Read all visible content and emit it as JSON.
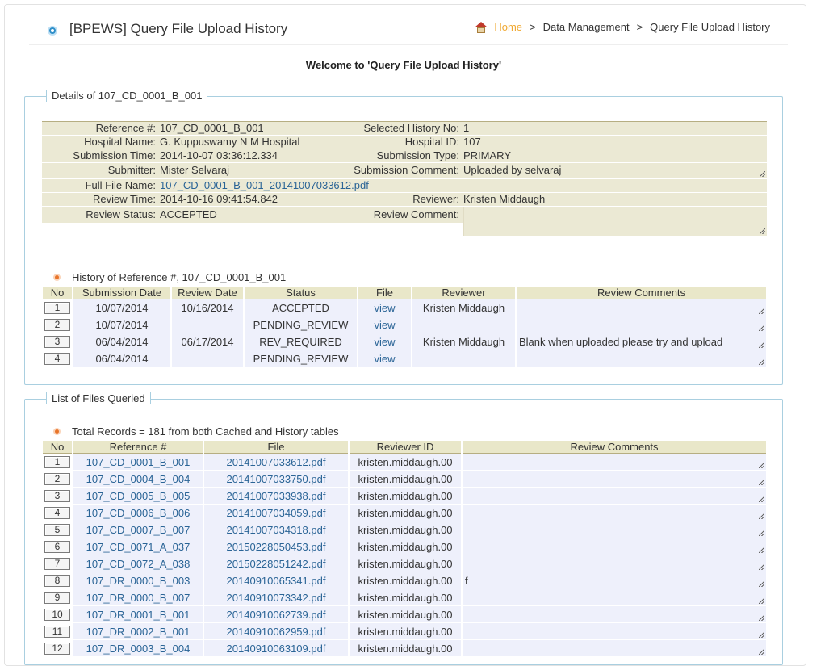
{
  "header": {
    "title": "[BPEWS] Query File Upload History",
    "breadcrumb": [
      "Home",
      "Data Management",
      "Query File Upload History"
    ],
    "sep": ">"
  },
  "welcome": "Welcome to 'Query File Upload History'",
  "details": {
    "legend": "Details of 107_CD_0001_B_001",
    "rows": [
      {
        "l1": "Reference #:",
        "v1": "107_CD_0001_B_001",
        "l2": "Selected History No:",
        "v2": "1"
      },
      {
        "l1": "Hospital Name:",
        "v1": "G. Kuppuswamy N M Hospital",
        "l2": "Hospital ID:",
        "v2": "107"
      },
      {
        "l1": "Submission Time:",
        "v1": "2014-10-07 03:36:12.334",
        "l2": "Submission Type:",
        "v2": "PRIMARY"
      },
      {
        "l1": "Submitter:",
        "v1": "Mister Selvaraj",
        "l2": "Submission Comment:",
        "v2": "Uploaded by selvaraj"
      },
      {
        "l1": "Full File Name:",
        "v1": "107_CD_0001_B_001_20141007033612.pdf"
      },
      {
        "l1": "Review Time:",
        "v1": "2014-10-16 09:41:54.842",
        "l2": "Reviewer:",
        "v2": "Kristen Middaugh"
      },
      {
        "l1": "Review Status:",
        "v1": "ACCEPTED",
        "l2": "Review Comment:",
        "v2": ""
      }
    ]
  },
  "history": {
    "label": "History of Reference #, 107_CD_0001_B_001",
    "columns": [
      "No",
      "Submission Date",
      "Review Date",
      "Status",
      "File",
      "Reviewer",
      "Review Comments"
    ],
    "rows": [
      {
        "no": "1",
        "sub": "10/07/2014",
        "rev": "10/16/2014",
        "status": "ACCEPTED",
        "file": "view",
        "reviewer": "Kristen Middaugh",
        "comment": ""
      },
      {
        "no": "2",
        "sub": "10/07/2014",
        "rev": "",
        "status": "PENDING_REVIEW",
        "file": "view",
        "reviewer": "",
        "comment": ""
      },
      {
        "no": "3",
        "sub": "06/04/2014",
        "rev": "06/17/2014",
        "status": "REV_REQUIRED",
        "file": "view",
        "reviewer": "Kristen Middaugh",
        "comment": "Blank when uploaded please try and upload"
      },
      {
        "no": "4",
        "sub": "06/04/2014",
        "rev": "",
        "status": "PENDING_REVIEW",
        "file": "view",
        "reviewer": "",
        "comment": ""
      }
    ]
  },
  "files": {
    "legend": "List of Files Queried",
    "total_label": "Total Records = 181 from both Cached and History tables",
    "columns": [
      "No",
      "Reference #",
      "File",
      "Reviewer ID",
      "Review Comments"
    ],
    "rows": [
      {
        "no": "1",
        "ref": "107_CD_0001_B_001",
        "file": "20141007033612.pdf",
        "reviewer": "kristen.middaugh.00",
        "comment": ""
      },
      {
        "no": "2",
        "ref": "107_CD_0004_B_004",
        "file": "20141007033750.pdf",
        "reviewer": "kristen.middaugh.00",
        "comment": ""
      },
      {
        "no": "3",
        "ref": "107_CD_0005_B_005",
        "file": "20141007033938.pdf",
        "reviewer": "kristen.middaugh.00",
        "comment": ""
      },
      {
        "no": "4",
        "ref": "107_CD_0006_B_006",
        "file": "20141007034059.pdf",
        "reviewer": "kristen.middaugh.00",
        "comment": ""
      },
      {
        "no": "5",
        "ref": "107_CD_0007_B_007",
        "file": "20141007034318.pdf",
        "reviewer": "kristen.middaugh.00",
        "comment": ""
      },
      {
        "no": "6",
        "ref": "107_CD_0071_A_037",
        "file": "20150228050453.pdf",
        "reviewer": "kristen.middaugh.00",
        "comment": ""
      },
      {
        "no": "7",
        "ref": "107_CD_0072_A_038",
        "file": "20150228051242.pdf",
        "reviewer": "kristen.middaugh.00",
        "comment": ""
      },
      {
        "no": "8",
        "ref": "107_DR_0000_B_003",
        "file": "20140910065341.pdf",
        "reviewer": "kristen.middaugh.00",
        "comment": "f"
      },
      {
        "no": "9",
        "ref": "107_DR_0000_B_007",
        "file": "20140910073342.pdf",
        "reviewer": "kristen.middaugh.00",
        "comment": ""
      },
      {
        "no": "10",
        "ref": "107_DR_0001_B_001",
        "file": "20140910062739.pdf",
        "reviewer": "kristen.middaugh.00",
        "comment": ""
      },
      {
        "no": "11",
        "ref": "107_DR_0002_B_001",
        "file": "20140910062959.pdf",
        "reviewer": "kristen.middaugh.00",
        "comment": ""
      },
      {
        "no": "12",
        "ref": "107_DR_0003_B_004",
        "file": "20140910063109.pdf",
        "reviewer": "kristen.middaugh.00",
        "comment": ""
      }
    ]
  }
}
